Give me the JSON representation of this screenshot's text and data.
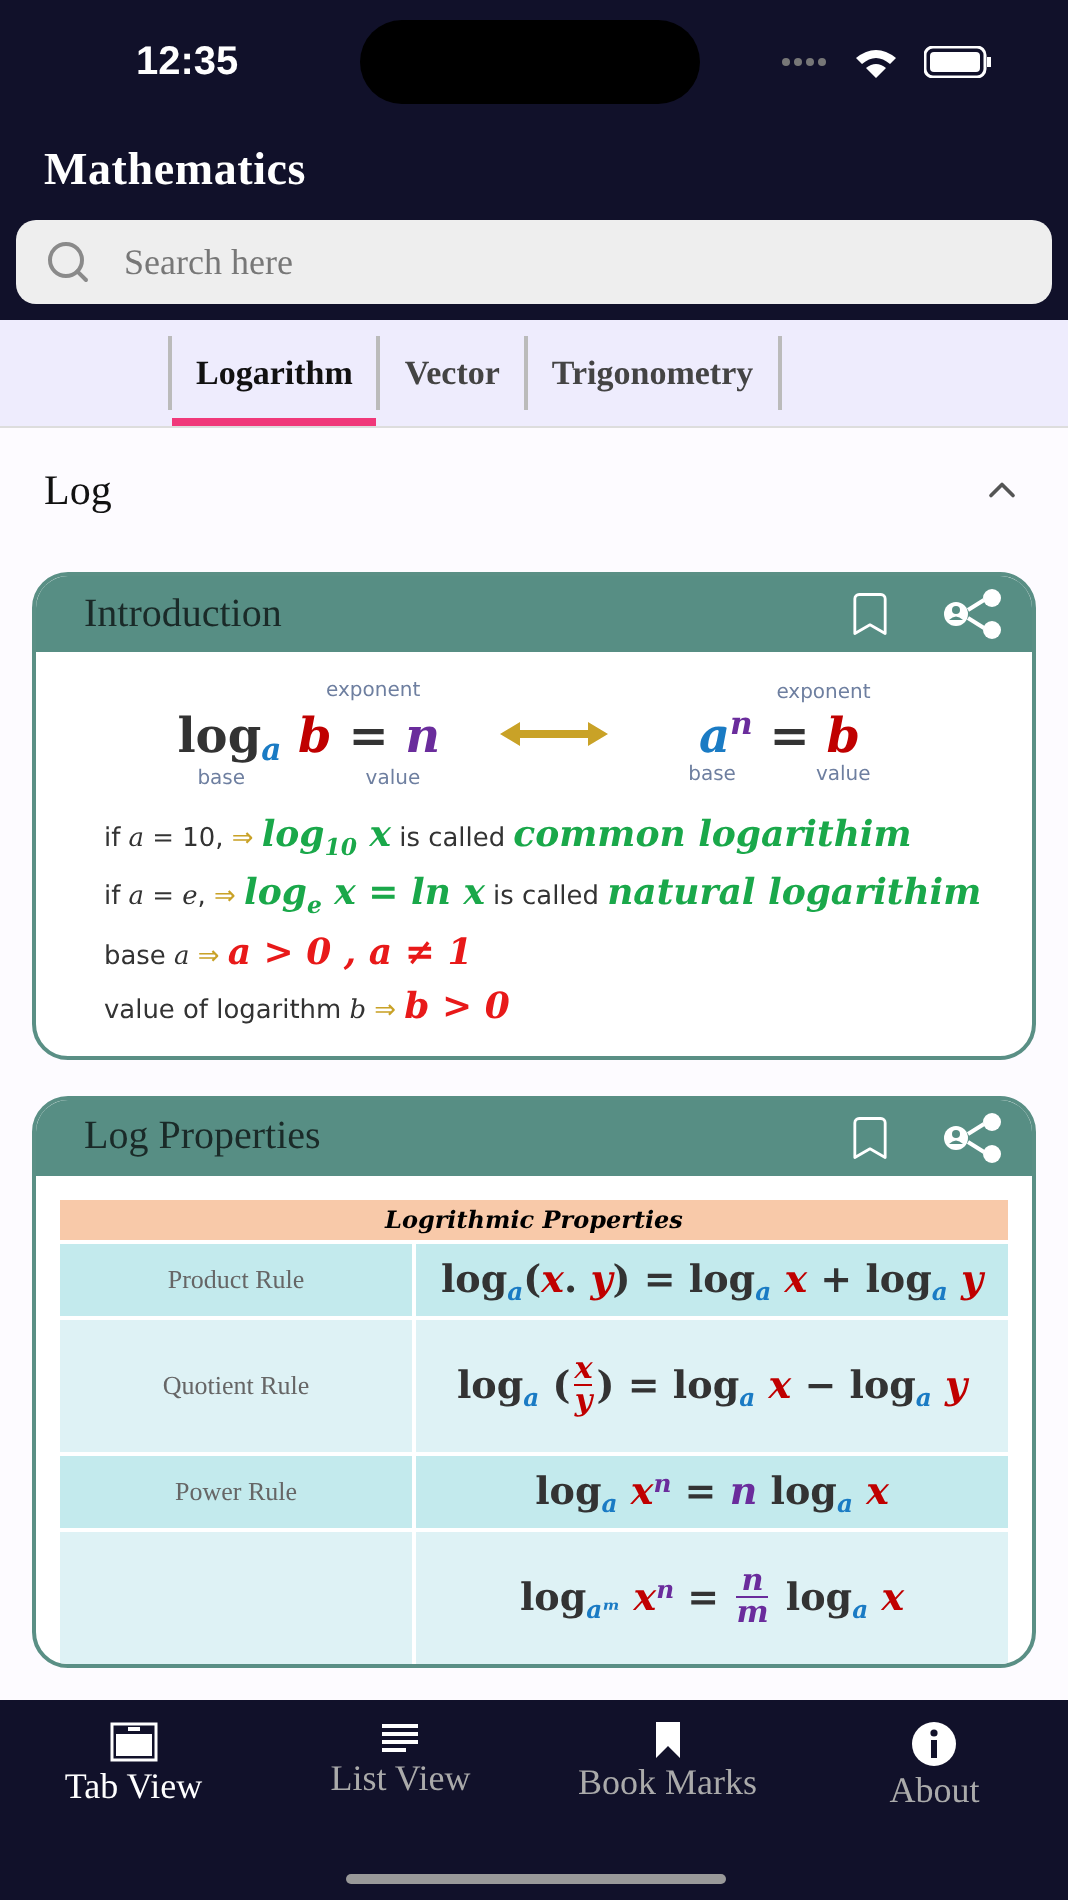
{
  "status_bar": {
    "time": "12:35"
  },
  "header": {
    "title": "Mathematics",
    "search": {
      "placeholder": "Search here"
    }
  },
  "tabs": [
    {
      "label": "Logarithm",
      "selected": true
    },
    {
      "label": "Vector",
      "selected": false
    },
    {
      "label": "Trigonometry",
      "selected": false
    }
  ],
  "section": {
    "title": "Log",
    "expanded": true
  },
  "cards": [
    {
      "title": "Introduction",
      "kind": "intro",
      "diagrams": [
        {
          "formula": [
            {
              "kind": "op",
              "text": "log",
              "color": "#333333"
            },
            {
              "kind": "bold",
              "text": "$_{a}$",
              "color": "#1a7bc4"
            },
            {
              "kind": "bold",
              "text": " b",
              "color": "#c00000"
            },
            {
              "kind": "op",
              "text": " = ",
              "color": "#333333"
            },
            {
              "kind": "bold",
              "text": "n",
              "color": "#6a2c9c"
            }
          ],
          "top_labels": [
            "exponent"
          ],
          "bottom_labels": [
            "base",
            "value"
          ]
        },
        {
          "formula": [
            {
              "kind": "bold",
              "text": "a",
              "color": "#1a7bc4"
            },
            {
              "kind": "bold",
              "text": "$^{n}$",
              "color": "#6a2c9c"
            },
            {
              "kind": "op",
              "text": " = ",
              "color": "#333333"
            },
            {
              "kind": "bold",
              "text": "b",
              "color": "#c00000"
            }
          ],
          "top_labels": [
            "exponent"
          ],
          "bottom_labels": [
            "base",
            "value"
          ]
        }
      ],
      "lines": [
        [
          {
            "kind": "plain",
            "text": "if ",
            "color": "#333333"
          },
          {
            "kind": "math",
            "text": "a",
            "color": "#333333"
          },
          {
            "kind": "plain",
            "text": " = 10, ",
            "color": "#333333"
          },
          {
            "kind": "plain",
            "text": "⇒ ",
            "color": "#c9a227"
          },
          {
            "kind": "bold",
            "text": "log$_{10}$ x",
            "color": "#1aa84a"
          },
          {
            "kind": "plain",
            "text": " is called ",
            "color": "#333333"
          },
          {
            "kind": "bold",
            "text": "common logarithim",
            "color": "#1aa84a"
          }
        ],
        [
          {
            "kind": "plain",
            "text": "if ",
            "color": "#333333"
          },
          {
            "kind": "math",
            "text": "a",
            "color": "#333333"
          },
          {
            "kind": "plain",
            "text": " = ",
            "color": "#333333"
          },
          {
            "kind": "math",
            "text": "e",
            "color": "#333333"
          },
          {
            "kind": "plain",
            "text": ", ",
            "color": "#333333"
          },
          {
            "kind": "plain",
            "text": "⇒ ",
            "color": "#c9a227"
          },
          {
            "kind": "bold",
            "text": "log$_{e}$ x = ln x",
            "color": "#1aa84a"
          },
          {
            "kind": "plain",
            "text": " is called ",
            "color": "#333333"
          },
          {
            "kind": "bold",
            "text": "natural logarithim",
            "color": "#1aa84a"
          }
        ],
        [
          {
            "kind": "plain",
            "text": "base ",
            "color": "#333333"
          },
          {
            "kind": "math",
            "text": "a",
            "color": "#333333"
          },
          {
            "kind": "plain",
            "text": " ⇒ ",
            "color": "#c9a227"
          },
          {
            "kind": "bold",
            "text": "a > 0 , a ≠ 1",
            "color": "#e81919"
          }
        ],
        [
          {
            "kind": "plain",
            "text": "value of logarithm ",
            "color": "#333333"
          },
          {
            "kind": "math",
            "text": "b",
            "color": "#333333"
          },
          {
            "kind": "plain",
            "text": " ⇒ ",
            "color": "#c9a227"
          },
          {
            "kind": "bold",
            "text": "b > 0",
            "color": "#e81919"
          }
        ]
      ]
    },
    {
      "title": "Log Properties",
      "kind": "table",
      "table": {
        "title": "Logrithmic Properties",
        "rows": [
          {
            "rule": "Product Rule",
            "formula": [
              {
                "kind": "op",
                "text": "log",
                "color": "#333333"
              },
              {
                "kind": "bold",
                "text": "$_{a}$",
                "color": "#1a7bc4"
              },
              {
                "kind": "op",
                "text": "(",
                "color": "#333333"
              },
              {
                "kind": "bold",
                "text": "x",
                "color": "#c00000"
              },
              {
                "kind": "op",
                "text": ". ",
                "color": "#333333"
              },
              {
                "kind": "bold",
                "text": "y",
                "color": "#c00000"
              },
              {
                "kind": "op",
                "text": ") = log",
                "color": "#333333"
              },
              {
                "kind": "bold",
                "text": "$_{a}$",
                "color": "#1a7bc4"
              },
              {
                "kind": "bold",
                "text": " x",
                "color": "#c00000"
              },
              {
                "kind": "op",
                "text": " + log",
                "color": "#333333"
              },
              {
                "kind": "bold",
                "text": "$_{a}$",
                "color": "#1a7bc4"
              },
              {
                "kind": "bold",
                "text": " y",
                "color": "#c00000"
              }
            ]
          },
          {
            "rule": "Quotient Rule",
            "formula": [
              {
                "kind": "op",
                "text": "log",
                "color": "#333333"
              },
              {
                "kind": "bold",
                "text": "$_{a}$",
                "color": "#1a7bc4"
              },
              {
                "kind": "op",
                "text": " (",
                "color": "#333333"
              },
              {
                "kind": "frac",
                "num": "x",
                "den": "y",
                "color": "#c00000"
              },
              {
                "kind": "op",
                "text": ") = log",
                "color": "#333333"
              },
              {
                "kind": "bold",
                "text": "$_{a}$",
                "color": "#1a7bc4"
              },
              {
                "kind": "bold",
                "text": " x",
                "color": "#c00000"
              },
              {
                "kind": "op",
                "text": " − log",
                "color": "#333333"
              },
              {
                "kind": "bold",
                "text": "$_{a}$",
                "color": "#1a7bc4"
              },
              {
                "kind": "bold",
                "text": " y",
                "color": "#c00000"
              }
            ]
          },
          {
            "rule": "Power Rule",
            "formula": [
              {
                "kind": "op",
                "text": "log",
                "color": "#333333"
              },
              {
                "kind": "bold",
                "text": "$_{a}$",
                "color": "#1a7bc4"
              },
              {
                "kind": "bold",
                "text": " x",
                "color": "#c00000"
              },
              {
                "kind": "bold",
                "text": "$^{n}$",
                "color": "#6a2c9c"
              },
              {
                "kind": "op",
                "text": " = ",
                "color": "#333333"
              },
              {
                "kind": "bold",
                "text": "n",
                "color": "#6a2c9c"
              },
              {
                "kind": "op",
                "text": " log",
                "color": "#333333"
              },
              {
                "kind": "bold",
                "text": "$_{a}$",
                "color": "#1a7bc4"
              },
              {
                "kind": "bold",
                "text": " x",
                "color": "#c00000"
              }
            ]
          },
          {
            "formula": [
              {
                "kind": "op",
                "text": "log",
                "color": "#333333"
              },
              {
                "kind": "bold",
                "text": "$_{aᵐ}$",
                "color": "#1a7bc4"
              },
              {
                "kind": "bold",
                "text": " x",
                "color": "#c00000"
              },
              {
                "kind": "bold",
                "text": "$^{n}$",
                "color": "#6a2c9c"
              },
              {
                "kind": "op",
                "text": " = ",
                "color": "#333333"
              },
              {
                "kind": "frac",
                "num": "n",
                "den": "m",
                "color": "#6a2c9c"
              },
              {
                "kind": "op",
                "text": " log",
                "color": "#333333"
              },
              {
                "kind": "bold",
                "text": "$_{a}$",
                "color": "#1a7bc4"
              },
              {
                "kind": "bold",
                "text": " x",
                "color": "#c00000"
              }
            ]
          }
        ]
      }
    }
  ],
  "bottom_nav": [
    {
      "label": "Tab View",
      "selected": true
    },
    {
      "label": "List View",
      "selected": false
    },
    {
      "label": "Book Marks",
      "selected": false
    },
    {
      "label": "About",
      "selected": false
    }
  ]
}
